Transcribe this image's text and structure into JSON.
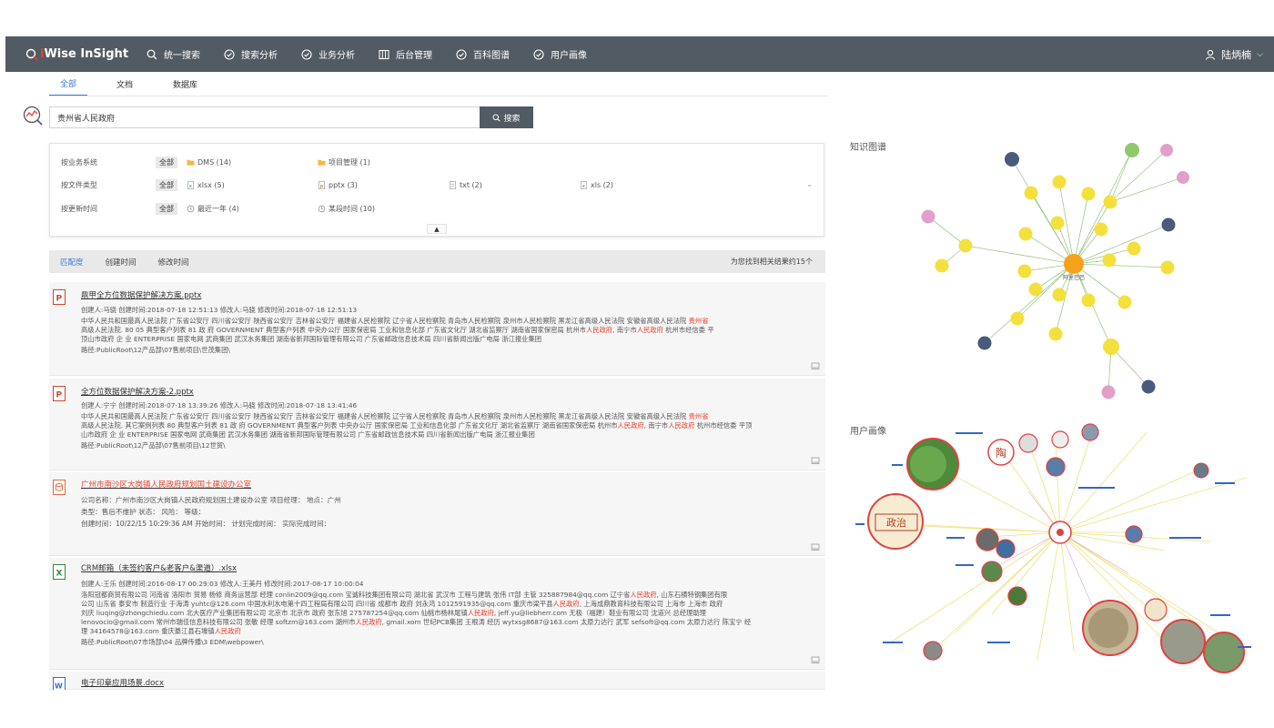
{
  "brand": {
    "prefix": "i",
    "name": "Wise InSight"
  },
  "nav": [
    {
      "label": "统一搜索",
      "icon": "search-icon"
    },
    {
      "label": "搜索分析",
      "icon": "check-circle-icon"
    },
    {
      "label": "业务分析",
      "icon": "check-circle-icon"
    },
    {
      "label": "后台管理",
      "icon": "grid-icon"
    },
    {
      "label": "百科图谱",
      "icon": "check-circle-icon"
    },
    {
      "label": "用户画像",
      "icon": "check-circle-icon"
    }
  ],
  "user": {
    "name": "陆炳楠"
  },
  "scope_tabs": [
    {
      "label": "全部",
      "active": true
    },
    {
      "label": "文档",
      "active": false
    },
    {
      "label": "数据库",
      "active": false
    }
  ],
  "search": {
    "value": "贵州省人民政府",
    "button": "搜索"
  },
  "filters": {
    "rows": [
      {
        "label": "按业务系统",
        "all": "全部",
        "options": [
          {
            "label": "DMS (14)",
            "icon": "folder-icon"
          },
          {
            "label": "项目管理 (1)",
            "icon": "folder-icon"
          }
        ]
      },
      {
        "label": "按文件类型",
        "all": "全部",
        "options": [
          {
            "label": "xlsx (5)",
            "icon": "xlsx-file-icon"
          },
          {
            "label": "pptx (3)",
            "icon": "pptx-file-icon"
          },
          {
            "label": "txt (2)",
            "icon": "txt-file-icon"
          },
          {
            "label": "xls (2)",
            "icon": "xls-file-icon"
          }
        ]
      },
      {
        "label": "按更新时间",
        "all": "全部",
        "options": [
          {
            "label": "最近一年 (4)",
            "icon": "clock-icon"
          },
          {
            "label": "某段时间 (10)",
            "icon": "clock-icon"
          }
        ]
      }
    ],
    "collapse": "▲",
    "expand": "⌄"
  },
  "sort": {
    "options": [
      {
        "label": "匹配度",
        "active": true
      },
      {
        "label": "创建时间",
        "active": false
      },
      {
        "label": "修改时间",
        "active": false
      }
    ],
    "count_text": "为您找到相关结果约15个"
  },
  "results": [
    {
      "type": "pptx",
      "title": "鼎甲全方位数据保护解决方案.pptx",
      "meta": "创建人:马骁  创建时间:2018-07-18 12:51:13  修改人:马骁  修改时间:2018-07-18 12:51:13",
      "snippet_1": "中华人民共和国最高人民法院 广东省公安厅 四川省公安厅 陕西省公安厅 吉林省公安厅 福建省人民检察院 辽宁省人民检察院 青岛市人民检察院 泉州市人民检察院 黑龙江省高级人民法院 安徽省高级人民法院 ",
      "snippet_1_hl": "贵州省",
      "snippet_2": "高级人民法院. 80 05 典型客户列表 81 政 府 GOVERNMENT 典型客户列表 中央办公厅 国家保密局 工业和信息化部 广东省文化厅 湖北省监察厅 湖南省国家保密局 杭州市",
      "snippet_2_hl": "人民政府",
      "snippet_2b": ", 南宁市",
      "snippet_2b_hl": "人民政府",
      "snippet_2c": " 杭州市经信委 平",
      "snippet_3": "顶山市政府 企 业 ENTERPRISE 国家电网 武商集团 武汉水务集团 湖南省新邦国际管理有限公司 广东省邮政信息技术局 四川省新闻出版广电局 浙江报业集团",
      "path": "路径:PublicRoot\\12产品部\\07售前项目\\世茂集团\\"
    },
    {
      "type": "pptx",
      "title": "全方位数据保护解决方案-2.pptx",
      "meta": "创建人:宁宁  创建时间:2018-07-18 13:39:26  修改人:马骁  修改时间:2018-07-18 13:41:46",
      "snippet_1": "中华人民共和国最高人民法院 广东省公安厅 四川省公安厅 陕西省公安厅 吉林省公安厅 福建省人民检察院 辽宁省人民检察院 青岛市人民检察院 泉州市人民检察院 黑龙江省高级人民法院 安徽省高级人民法院 ",
      "snippet_1_hl": "贵州省",
      "snippet_2": "高级人民法院. 其它案例列表 80 典型客户列表 81 政 府 GOVERNMENT 典型客户列表 中央办公厅 国家保密局 工业和信息化部 广东省文化厅 湖北省监察厅 湖南省国家保密局 杭州市",
      "snippet_2_hl": "人民政府",
      "snippet_2b": ", 南宁市",
      "snippet_2b_hl": "人民政府",
      "snippet_2c": " 杭州市经信委 平顶",
      "snippet_3": "山市政府 企 业 ENTERPRISE 国家电网 武商集团 武汉水务集团 湖南省新邦国际管理有限公司 广东省邮政信息技术局 四川省新闻出版广电局 浙江报业集团",
      "path": "路径:PublicRoot\\12产品部\\07售前项目\\12世贸\\"
    },
    {
      "type": "db",
      "title_a": "广州市南沙区大岗镇",
      "title_hl": "人民政府",
      "title_b": "规划国土建设办公室",
      "line_1": "公司名称：广州市南沙区大岗镇人民政府规划国土建设办公室 项目经理：  地点：广州",
      "line_2": "类型：售后不维护 状态：  风险：  等级：",
      "line_3": "创建时间：10/22/15 10:29:36 AM 开始时间：  计划完成时间：  实际完成时间："
    },
    {
      "type": "xlsx",
      "title": "CRM邮箱（未签约客户&老客户&渠道）.xlsx",
      "meta": "创建人:王乐  创建时间:2016-08-17 00:29:03  修改人:王美丹  修改时间:2017-08-17 10:00:04",
      "snippet_1": "洛阳冠都商贸有限公司 河南省 洛阳市 贸易 杨修 商务运营部 经理 conlin2009@qq.com 宝诚科技集团有限公司 湖北省 武汉市 工程与建筑 张伟 IT部 主管 325887984@qq.com 辽宁省",
      "snippet_1_hl": "人民政府",
      "snippet_1b": ", 山东石横特钢集团有限",
      "snippet_2": "公司 山东省 泰安市 制造行业 于海涛 yuhtc@126.com 中国水利水电第十四工程局有限公司 四川省 成都市 政府 刘永鸿 1012591935@qq.com 重庆市梁平县",
      "snippet_2_hl": "人民政府",
      "snippet_2b": ", 上海成鼎教育科技有限公司 上海市 上海市 政府",
      "snippet_3": "刘庆 liuqing@zhongchiedu.com 北大医疗产业集团有限公司 北京市 北京市 政府 张东旭 275787254@qq.com 仙桃市杨林尾镇",
      "snippet_3_hl": "人民政府",
      "snippet_3b": ", jeff.yu@liebherr.com 无极（福建）鞋业有限公司 沈道兴 总经理助理",
      "snippet_4": "lenovocio@gmail.com 常州市瑞佳信息科技有限公司 张敏 经理 softzm@163.com 湖州市",
      "snippet_4_hl": "人民政府",
      "snippet_4b": ", gmail.xom 世纪PCB集团 王根涛 经历 wytxsg8687@163.com 太原力达行 武军 sefsoft@qq.com 太原力达行 陈宝宁 经",
      "snippet_5": "理 34164578@163.com 重庆綦江县石壕镇",
      "snippet_5_hl": "人民政府",
      "path": "路径:PublicRoot\\07市场部\\04 品牌传播\\3 EDM\\webpower\\"
    },
    {
      "type": "docx",
      "title": "电子印章应用场景.docx"
    }
  ],
  "panels": {
    "knowledge_graph": "知识图谱",
    "user_portrait": "用户画像"
  },
  "kg_center": "阿里巴巴",
  "up_badge_1": "政治",
  "up_badge_2": "陶"
}
